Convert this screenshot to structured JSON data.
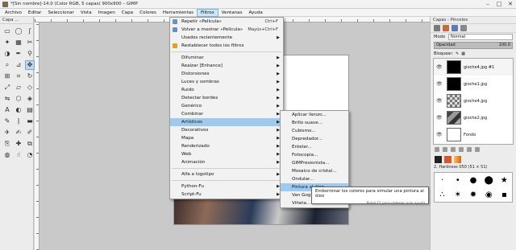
{
  "window": {
    "title": "*[Sin nombre]-14.0 (Color RGB, 5 capas) 900x900 – GIMP",
    "controls": [
      "–",
      "□",
      "✕"
    ]
  },
  "menubar": [
    "Archivo",
    "Editar",
    "Seleccionar",
    "Vista",
    "Imagen",
    "Capa",
    "Colores",
    "Herramientas",
    "Filtros",
    "Ventanas",
    "Ayuda"
  ],
  "toolbox": {
    "title": "Capa ..."
  },
  "filters_menu": {
    "repeat": {
      "label": "Repetir «Película»",
      "shortcut": "Ctrl+F"
    },
    "reshow": {
      "label": "Volver a mostrar «Película»",
      "shortcut": "Mayús+Ctrl+F"
    },
    "recent": "Usados recientemente",
    "reset": "Restablecer todos los filtros",
    "groups": [
      "Difuminar",
      "Realzar [Enhance]",
      "Distorsiones",
      "Luces y sombras",
      "Ruido",
      "Detectar bordes",
      "Genérico",
      "Combinar",
      "Artísticos",
      "Decorativos",
      "Mapa",
      "Renderizado",
      "Web",
      "Animación"
    ],
    "alfa": "Alfa a logotipo",
    "python": "Python-Fu",
    "script": "Script-Fu"
  },
  "artistic_menu": [
    "Aplicar lienzo...",
    "Brillo suave...",
    "Cubismo...",
    "Depredador...",
    "Entelar...",
    "Fotocopia...",
    "GIMPresionista...",
    "Mosaico de cristal...",
    "Ondular...",
    "Pintura al óleo...",
    "Van Gogh (LIC)...",
    "Viñeta..."
  ],
  "tooltip": {
    "text": "Emborronar los colores para simular una pintura al óleo",
    "hint": "Pulse F1 para obtener más ayuda"
  },
  "dock": {
    "title": "Capas - Pinceles",
    "mode_label": "Modo",
    "mode_value": "Normal",
    "opacity_label": "Opacidad",
    "opacity_value": "100.0",
    "lock_label": "Bloquear:",
    "layers": [
      {
        "name": "gioche4.jpg #1",
        "thumb": "black"
      },
      {
        "name": "gioche1.jpg",
        "thumb": "black"
      },
      {
        "name": "gioche4.jpg",
        "thumb": "checker"
      },
      {
        "name": "gioche2.jpg",
        "thumb": "img"
      },
      {
        "name": "Fondo",
        "thumb": "white"
      }
    ],
    "brush_name": "2. Hardness 050 (51 × 51)"
  },
  "colors": {
    "menu_highlight": "#9fcaf0",
    "menubar_active": "#cde6f7",
    "tooltip_bg": "#ffffff"
  }
}
